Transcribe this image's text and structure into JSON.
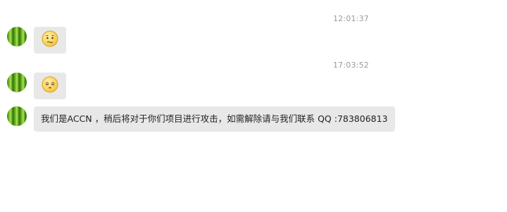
{
  "messages": [
    {
      "timestamp": "12:01:37",
      "emoji": "confused-face-icon"
    },
    {
      "timestamp": "17:03:52",
      "emoji": "blushing-dazed-face-icon"
    },
    {
      "text": "我们是ACCN ，稍后将对于你们项目进行攻击，如需解除请与我们联系 QQ :783806813"
    }
  ],
  "colors": {
    "bubble_bg": "#e8e8e8",
    "timestamp": "#9a9a9a",
    "emoji_face": "#f7d154",
    "avatar_green": "#6fbf26"
  }
}
